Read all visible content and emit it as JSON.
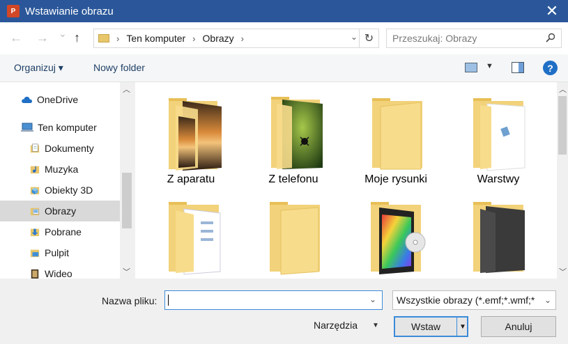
{
  "window": {
    "app_icon_text": "P",
    "title": "Wstawianie obrazu",
    "close_glyph": "✕"
  },
  "nav": {
    "back_glyph": "←",
    "forward_glyph": "→",
    "recent_glyph": "⌄",
    "up_glyph": "↑",
    "breadcrumbs": [
      "Ten komputer",
      "Obrazy"
    ],
    "separator": "›",
    "dropdown_glyph": "⌄",
    "refresh_glyph": "↻",
    "search_placeholder": "Przeszukaj: Obrazy"
  },
  "toolbar": {
    "organize_label": "Organizuj ▾",
    "new_folder_label": "Nowy folder",
    "view_dd_glyph": "▼",
    "help_glyph": "?"
  },
  "sidebar": {
    "items": [
      {
        "label": "OneDrive",
        "icon": "cloud-icon",
        "color": "#1f6fc5"
      },
      {
        "label": "Ten komputer",
        "icon": "computer-icon",
        "color": "#4a8fd1"
      },
      {
        "label": "Dokumenty",
        "icon": "documents-icon",
        "color": "#d9b24c"
      },
      {
        "label": "Muzyka",
        "icon": "music-icon",
        "color": "#d9b24c"
      },
      {
        "label": "Obiekty 3D",
        "icon": "3d-objects-icon",
        "color": "#5fa8e0"
      },
      {
        "label": "Obrazy",
        "icon": "pictures-icon",
        "color": "#d9b24c",
        "selected": true
      },
      {
        "label": "Pobrane",
        "icon": "downloads-icon",
        "color": "#2b7bd1"
      },
      {
        "label": "Pulpit",
        "icon": "desktop-icon",
        "color": "#3f8fd8"
      },
      {
        "label": "Wideo",
        "icon": "video-icon",
        "color": "#6b5a3a"
      }
    ]
  },
  "files": {
    "items": [
      {
        "label": "Z aparatu",
        "icon": "folder-photos-icon"
      },
      {
        "label": "Z telefonu",
        "icon": "folder-photos-icon"
      },
      {
        "label": "Moje rysunki",
        "icon": "folder-icon"
      },
      {
        "label": "Warstwy",
        "icon": "folder-document-icon"
      },
      {
        "label": "",
        "icon": "folder-document-icon"
      },
      {
        "label": "",
        "icon": "folder-icon"
      },
      {
        "label": "",
        "icon": "folder-media-icon"
      },
      {
        "label": "",
        "icon": "folder-dark-icon"
      }
    ]
  },
  "footer": {
    "filename_label": "Nazwa pliku:",
    "filename_value": "",
    "filter_value": "Wszystkie obrazy (*.emf;*.wmf;*",
    "dropdown_glyph": "⌄",
    "tools_label": "Narzędzia",
    "tools_arrow": "▼",
    "insert_label": "Wstaw",
    "insert_split_glyph": "▼",
    "cancel_label": "Anuluj"
  },
  "colors": {
    "titlebar": "#2b579a",
    "accent": "#3b8ad9",
    "selection": "#d9d9d9"
  }
}
